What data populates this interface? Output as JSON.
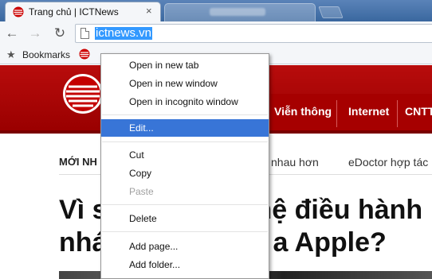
{
  "tabs": {
    "active_title": "Trang chủ | ICTNews",
    "close_glyph": "×"
  },
  "toolbar": {
    "back_glyph": "←",
    "forward_glyph": "→",
    "reload_glyph": "↻",
    "url": "ictnews.vn"
  },
  "bookmarks_bar": {
    "star_glyph": "★",
    "label": "Bookmarks"
  },
  "site": {
    "nav_items": [
      "Viễn thông",
      "Internet",
      "CNTT"
    ],
    "ticker_label": "MỚI NH",
    "ticker_items": [
      "nhau hơn",
      "eDoctor hợp tác"
    ],
    "headline_lines": [
      "Vì s",
      "nhá"
    ],
    "headline_tail": [
      "hệ điều hành",
      "a Apple?"
    ]
  },
  "context_menu": {
    "items": [
      {
        "label": "Open in new tab",
        "enabled": true,
        "highlighted": false
      },
      {
        "label": "Open in new window",
        "enabled": true,
        "highlighted": false
      },
      {
        "label": "Open in incognito window",
        "enabled": true,
        "highlighted": false
      },
      {
        "label": "Edit...",
        "enabled": true,
        "highlighted": true
      },
      {
        "label": "Cut",
        "enabled": true,
        "highlighted": false
      },
      {
        "label": "Copy",
        "enabled": true,
        "highlighted": false
      },
      {
        "label": "Paste",
        "enabled": false,
        "highlighted": false
      },
      {
        "label": "Delete",
        "enabled": true,
        "highlighted": false
      },
      {
        "label": "Add page...",
        "enabled": true,
        "highlighted": false
      },
      {
        "label": "Add folder...",
        "enabled": true,
        "highlighted": false
      }
    ]
  },
  "colors": {
    "brand_red": "#b80c0c",
    "menu_highlight": "#3875d7",
    "url_selection": "#3399ff"
  }
}
